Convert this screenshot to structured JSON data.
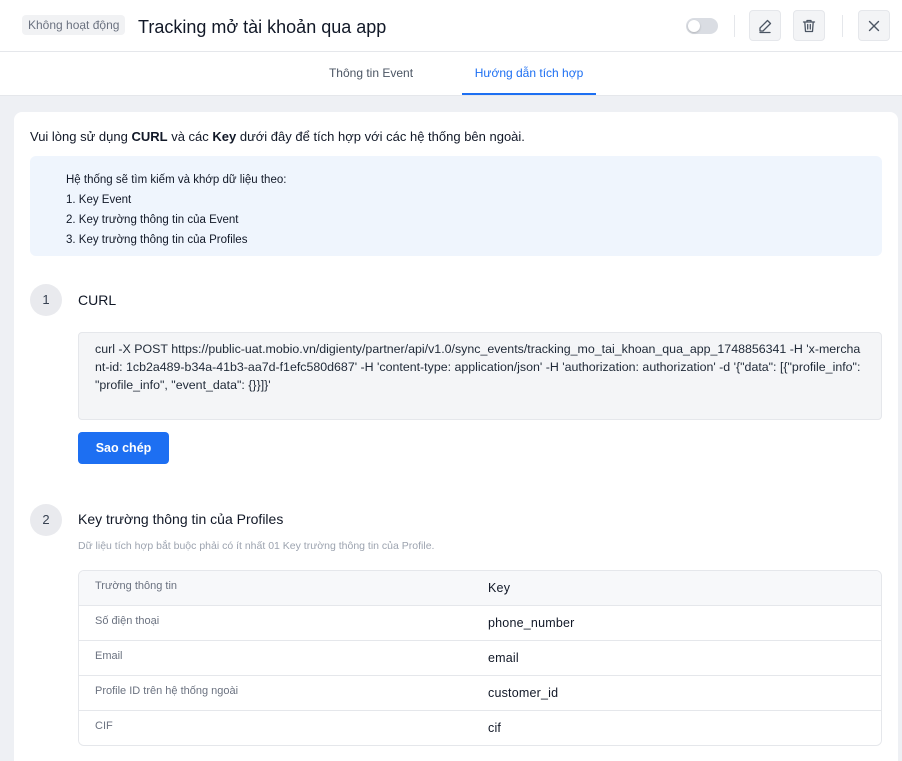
{
  "header": {
    "status_badge": "Không hoạt động",
    "title": "Tracking mở tài khoản qua app",
    "icons": [
      "toggle-switch",
      "edit-icon",
      "trash-icon",
      "close-icon"
    ]
  },
  "tabs": [
    {
      "label": "Thông tin Event",
      "active": false
    },
    {
      "label": "Hướng dẫn tích hợp",
      "active": true
    }
  ],
  "intro": {
    "before": "Vui lòng sử dụng ",
    "curl": "CURL",
    "middle": " và các ",
    "key": "Key",
    "after": " dưới đây để tích hợp với các hệ thống bên ngoài."
  },
  "info_box": {
    "heading": "Hệ thống sẽ tìm kiếm và khớp dữ liệu theo:",
    "items": [
      "1. Key Event",
      "2. Key trường thông tin của Event",
      "3. Key trường thông tin của Profiles"
    ]
  },
  "step1": {
    "number": "1",
    "title": "CURL",
    "code": "curl -X POST https://public-uat.mobio.vn/digienty/partner/api/v1.0/sync_events/tracking_mo_tai_khoan_qua_app_1748856341 -H 'x-merchant-id: 1cb2a489-b34a-41b3-aa7d-f1efc580d687' -H 'content-type: application/json' -H 'authorization: authorization' -d '{\"data\": [{\"profile_info\": \"profile_info\", \"event_data\": {}}]}'",
    "copy_label": "Sao chép"
  },
  "step2": {
    "number": "2",
    "title": "Key trường thông tin của Profiles",
    "description": "Dữ liệu tích hợp bắt buộc phải có ít nhất 01 Key trường thông tin của Profile.",
    "table": {
      "headers": {
        "field": "Trường thông tin",
        "key": "Key"
      },
      "rows": [
        {
          "field": "Số điện thoại",
          "key": "phone_number"
        },
        {
          "field": "Email",
          "key": "email"
        },
        {
          "field": "Profile ID trên hệ thống ngoài",
          "key": "customer_id"
        },
        {
          "field": "CIF",
          "key": "cif"
        }
      ]
    }
  },
  "colors": {
    "accent": "#1d6ff2",
    "info_bg": "#eff5fd",
    "page_bg": "#eef0f4"
  }
}
